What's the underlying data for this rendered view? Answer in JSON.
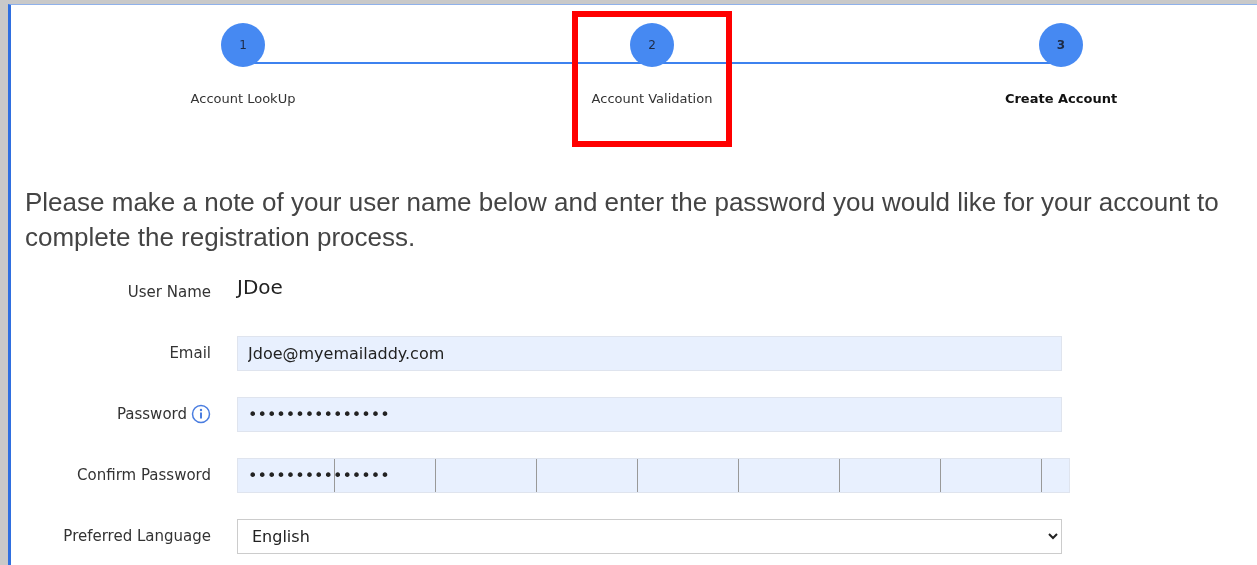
{
  "steps": [
    {
      "number": "1",
      "label": "Account LookUp",
      "current": false,
      "highlighted": false
    },
    {
      "number": "2",
      "label": "Account Validation",
      "current": false,
      "highlighted": true
    },
    {
      "number": "3",
      "label": "Create Account",
      "current": true,
      "highlighted": false
    }
  ],
  "intro": "Please make a note of your user name below and enter the password you would like for your account to complete the registration process.",
  "fields": [
    {
      "kind": "static",
      "label": "User Name",
      "value": "JDoe"
    },
    {
      "kind": "input",
      "label": "Email",
      "value": "Jdoe@myemailaddy.com"
    },
    {
      "kind": "input",
      "label": "Password",
      "value": "•••••••••••••••",
      "info": true
    },
    {
      "kind": "input",
      "label": "Confirm Password",
      "value": "•••••••••••••••",
      "wide": true
    },
    {
      "kind": "select",
      "label": "Preferred Language",
      "value": "English"
    }
  ]
}
